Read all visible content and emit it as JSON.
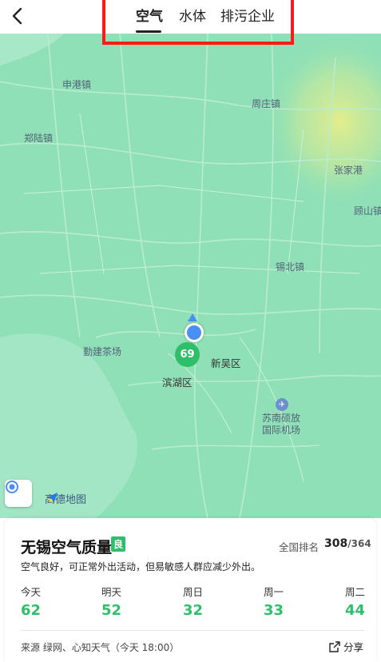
{
  "header": {
    "tabs": [
      "空气",
      "水体",
      "排污企业"
    ],
    "active_tab": "空气"
  },
  "map": {
    "places": {
      "shengang": "申港镇",
      "zhouzhuang": "周庄镇",
      "zhengluxiang": "郑陆镇",
      "zhangjiagang": "张家港",
      "gushan": "顾山镇",
      "xibei": "锡北镇",
      "qinjian": "勤建茶场",
      "xinwu": "新吴区",
      "binhu": "滨湖区",
      "airport_line1": "苏南硕放",
      "airport_line2": "国际机场"
    },
    "aqi_marker": "69",
    "map_brand": "高德地图"
  },
  "card": {
    "title": "无锡空气质量",
    "quality": "良",
    "rank_label": "全国排名",
    "rank": "308",
    "rank_total": "/364",
    "description": "空气良好，可正常外出活动，但易敏感人群应减少外出。",
    "forecast": [
      {
        "day": "今天",
        "value": "62"
      },
      {
        "day": "明天",
        "value": "52"
      },
      {
        "day": "周日",
        "value": "32"
      },
      {
        "day": "周一",
        "value": "33"
      },
      {
        "day": "周二",
        "value": "44"
      }
    ],
    "source": "来源 绿网、心知天气（今天 18:00）",
    "share_label": "分享"
  },
  "colors": {
    "accent_green": "#2fbe6a",
    "map_bg": "#8fe0b7",
    "tab_highlight_border": "#ff1a1a",
    "locate_blue": "#4a8ff5"
  }
}
